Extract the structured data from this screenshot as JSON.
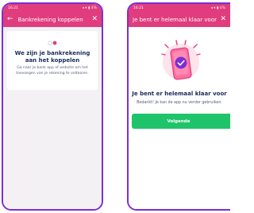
{
  "screen1": {
    "status_time": "16:21",
    "status_right": "◂ ▾ ▮ 4%",
    "title": "Bankrekening koppelen",
    "heading": "We zijn je bankrekening aan het koppelen",
    "description": "Ga naar je bank app of website om het toevoegen van je rekening te voltooien."
  },
  "screen2": {
    "status_time": "16:21",
    "status_right": "◂ ▾ ▮ 4%",
    "title": "Je bent er helemaal klaar voor",
    "heading": "Je bent er helemaal klaar voor",
    "description": "Bedankt! Je kan de app nu verder gebruiken.",
    "button_label": "Volgende"
  },
  "colors": {
    "accent": "#e03c7e",
    "frame": "#7b2fd4",
    "primary_text": "#1a2b5c",
    "button": "#1fc46a"
  }
}
